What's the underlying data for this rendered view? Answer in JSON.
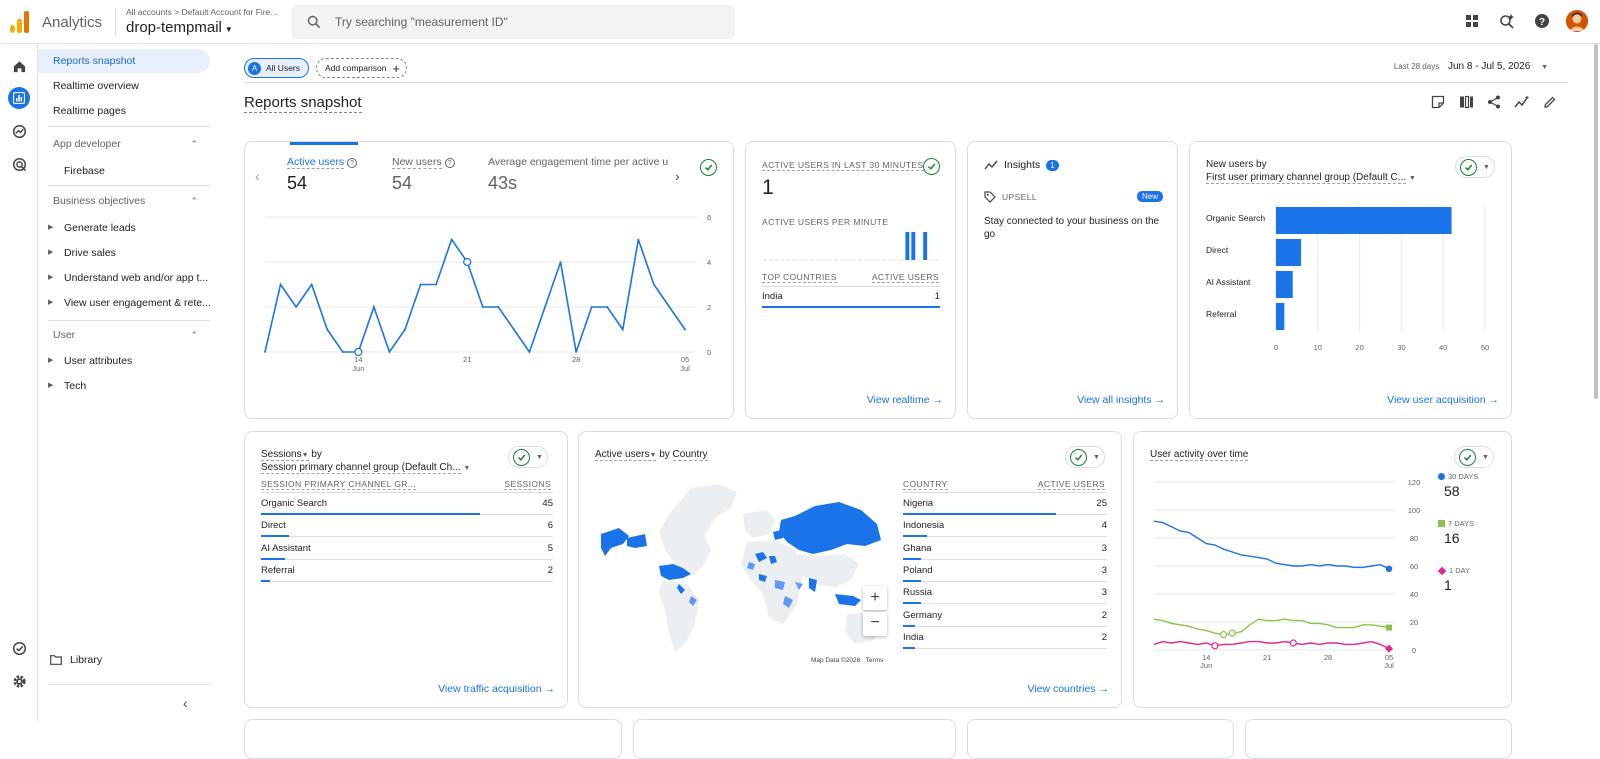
{
  "topbar": {
    "app_name": "Analytics",
    "breadcrumb": "All accounts > Default Account for Fire...",
    "property": "drop-tempmail",
    "search_placeholder": "Try searching \"measurement ID\""
  },
  "sidebar": {
    "top_items": [
      "Reports snapshot",
      "Realtime overview",
      "Realtime pages"
    ],
    "app_developer": {
      "label": "App developer",
      "items": [
        "Firebase"
      ]
    },
    "business_objectives": {
      "label": "Business objectives",
      "items": [
        "Generate leads",
        "Drive sales",
        "Understand web and/or app t...",
        "View user engagement & rete..."
      ]
    },
    "user": {
      "label": "User",
      "items": [
        "User attributes",
        "Tech"
      ]
    },
    "library": "Library"
  },
  "header": {
    "chip_all_users": "All Users",
    "chip_all_letter": "A",
    "add_comparison": "Add comparison",
    "date_label": "Last 28 days",
    "date_range": "Jun 8 - Jul 5, 2026",
    "page_title": "Reports snapshot"
  },
  "overview": {
    "metrics": [
      {
        "label": "Active users",
        "value": "54"
      },
      {
        "label": "New users",
        "value": "54"
      },
      {
        "label": "Average engagement time per active us",
        "value": "43s"
      }
    ],
    "chart_data": {
      "type": "line",
      "x": [
        "Jun 8",
        "Jun 9",
        "Jun 10",
        "Jun 11",
        "Jun 12",
        "Jun 13",
        "Jun 14",
        "Jun 15",
        "Jun 16",
        "Jun 17",
        "Jun 18",
        "Jun 19",
        "Jun 20",
        "Jun 21",
        "Jun 22",
        "Jun 23",
        "Jun 24",
        "Jun 25",
        "Jun 26",
        "Jun 27",
        "Jun 28",
        "Jun 29",
        "Jun 30",
        "Jul 1",
        "Jul 2",
        "Jul 3",
        "Jul 4",
        "Jul 5"
      ],
      "series": [
        {
          "values": [
            0,
            3,
            2,
            3,
            1,
            0,
            0,
            2,
            0,
            1,
            3,
            3,
            5,
            4,
            2,
            2,
            1,
            0,
            2,
            4,
            0,
            2,
            2,
            1,
            5,
            3,
            2,
            1
          ]
        }
      ],
      "x_ticks": [
        {
          "index": 6,
          "label": "14",
          "sub": "Jun"
        },
        {
          "index": 13,
          "label": "21",
          "sub": ""
        },
        {
          "index": 20,
          "label": "28",
          "sub": ""
        },
        {
          "index": 27,
          "label": "05",
          "sub": "Jul"
        }
      ],
      "y_ticks": [
        "0",
        "2",
        "4",
        "6"
      ],
      "ylim": [
        0,
        6
      ]
    }
  },
  "realtime": {
    "title": "ACTIVE USERS IN LAST 30 MINUTES",
    "value": "1",
    "per_minute_label": "ACTIVE USERS PER MINUTE",
    "per_minute_values": [
      0,
      0,
      0,
      0,
      0,
      0,
      0,
      0,
      0,
      0,
      0,
      0,
      0,
      0,
      0,
      0,
      0,
      0,
      0,
      0,
      0,
      0,
      0,
      0,
      1,
      1,
      0,
      1,
      0,
      0
    ],
    "col_country": "TOP COUNTRIES",
    "col_users": "ACTIVE USERS",
    "rows": [
      {
        "name": "India",
        "value": "1"
      }
    ],
    "link": "View realtime"
  },
  "insights": {
    "title": "Insights",
    "count": "1",
    "upsell": "UPSELL",
    "badge": "New",
    "text": "Stay connected to your business on the go",
    "link": "View all insights"
  },
  "acquisition": {
    "title": "New users by",
    "dimension": "First user primary channel group (Default C...",
    "chart_data": {
      "type": "bar",
      "categories": [
        "Organic Search",
        "Direct",
        "AI Assistant",
        "Referral"
      ],
      "values": [
        42,
        6,
        4,
        2
      ],
      "x_ticks": [
        "0",
        "10",
        "20",
        "30",
        "40",
        "50"
      ],
      "xlim": [
        0,
        50
      ]
    },
    "link": "View user acquisition"
  },
  "sessions": {
    "title": "Sessions",
    "by": "by",
    "dimension": "Session primary channel group (Default Ch...",
    "col_dim": "SESSION PRIMARY CHANNEL GR...",
    "col_val": "SESSIONS",
    "rows": [
      {
        "name": "Organic Search",
        "value": "45",
        "pct": 100
      },
      {
        "name": "Direct",
        "value": "6",
        "pct": 13
      },
      {
        "name": "AI Assistant",
        "value": "5",
        "pct": 11
      },
      {
        "name": "Referral",
        "value": "2",
        "pct": 4
      }
    ],
    "link": "View traffic acquisition"
  },
  "countries": {
    "title": "Active users",
    "by": "by",
    "dimension": "Country",
    "col_dim": "COUNTRY",
    "col_val": "ACTIVE USERS",
    "rows": [
      {
        "name": "Nigeria",
        "value": "25",
        "pct": 100
      },
      {
        "name": "Indonesia",
        "value": "4",
        "pct": 16
      },
      {
        "name": "Ghana",
        "value": "3",
        "pct": 12
      },
      {
        "name": "Poland",
        "value": "3",
        "pct": 12
      },
      {
        "name": "Russia",
        "value": "3",
        "pct": 12
      },
      {
        "name": "Germany",
        "value": "2",
        "pct": 8
      },
      {
        "name": "India",
        "value": "2",
        "pct": 8
      }
    ],
    "map_credit": "Map Data ©2026",
    "terms": "Terms",
    "link": "View countries"
  },
  "activity": {
    "title": "User activity over time",
    "legend": [
      {
        "label": "30 DAYS",
        "value": "58",
        "color": "#1a73e8"
      },
      {
        "label": "7 DAYS",
        "value": "16",
        "color": "#8bc34a"
      },
      {
        "label": "1 DAY",
        "value": "1",
        "color": "#e52592"
      }
    ],
    "chart_data": {
      "type": "line",
      "x": [
        "Jun 8",
        "Jun 9",
        "Jun 10",
        "Jun 11",
        "Jun 12",
        "Jun 13",
        "Jun 14",
        "Jun 15",
        "Jun 16",
        "Jun 17",
        "Jun 18",
        "Jun 19",
        "Jun 20",
        "Jun 21",
        "Jun 22",
        "Jun 23",
        "Jun 24",
        "Jun 25",
        "Jun 26",
        "Jun 27",
        "Jun 28",
        "Jun 29",
        "Jun 30",
        "Jul 1",
        "Jul 2",
        "Jul 3",
        "Jul 4",
        "Jul 5"
      ],
      "series": [
        {
          "name": "30 DAYS",
          "values": [
            92,
            91,
            88,
            85,
            84,
            80,
            76,
            75,
            72,
            70,
            68,
            67,
            66,
            65,
            62,
            61,
            60,
            60,
            61,
            60,
            61,
            60,
            60,
            59,
            59,
            60,
            61,
            58
          ]
        },
        {
          "name": "7 DAYS",
          "values": [
            22,
            21,
            19,
            18,
            17,
            15,
            14,
            12,
            11,
            12,
            13,
            18,
            22,
            21,
            21,
            22,
            21,
            21,
            19,
            19,
            18,
            16,
            16,
            16,
            18,
            18,
            17,
            16
          ]
        },
        {
          "name": "1 DAY",
          "values": [
            4,
            6,
            5,
            6,
            5,
            4,
            5,
            3,
            4,
            4,
            5,
            6,
            6,
            5,
            5,
            6,
            5,
            4,
            5,
            4,
            5,
            5,
            4,
            4,
            5,
            6,
            4,
            1
          ]
        }
      ],
      "x_ticks": [
        {
          "index": 6,
          "label": "14",
          "sub": "Jun"
        },
        {
          "index": 13,
          "label": "21",
          "sub": ""
        },
        {
          "index": 20,
          "label": "28",
          "sub": ""
        },
        {
          "index": 27,
          "label": "05",
          "sub": "Jul"
        }
      ],
      "y_ticks": [
        "0",
        "20",
        "40",
        "60",
        "80",
        "100",
        "120"
      ],
      "ylim": [
        0,
        120
      ]
    }
  }
}
